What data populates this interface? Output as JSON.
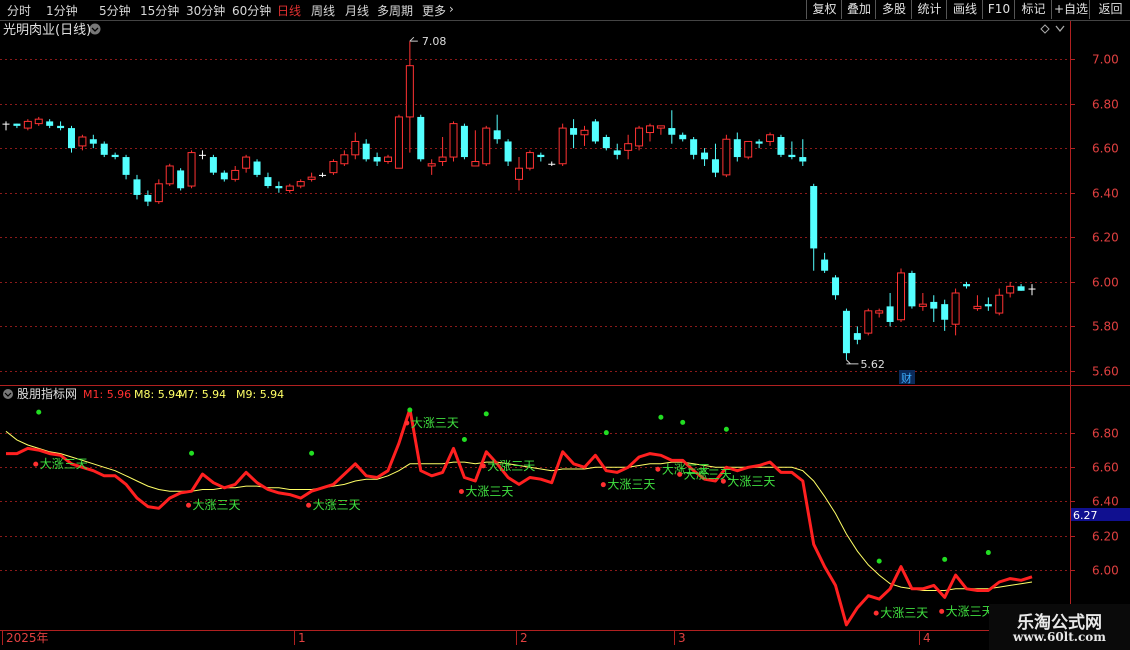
{
  "toolbar": {
    "tabs": [
      "分时",
      "1分钟",
      "5分钟",
      "15分钟",
      "30分钟",
      "60分钟",
      "日线",
      "周线",
      "月线",
      "多周期",
      "更多"
    ],
    "active_tab": "日线",
    "right_buttons": [
      "复权",
      "叠加",
      "多股",
      "统计",
      "画线",
      "F10",
      "标记",
      "+自选",
      "返回"
    ]
  },
  "main_panel": {
    "title": "光明肉业(日线)",
    "high_label": "7.08",
    "low_label": "5.62",
    "event_marker": "财",
    "yaxis_labels": [
      "7.00",
      "6.80",
      "6.60",
      "6.40",
      "6.20",
      "6.00",
      "5.80",
      "5.60"
    ],
    "yaxis_values": [
      7.0,
      6.8,
      6.6,
      6.4,
      6.2,
      6.0,
      5.8,
      5.6
    ],
    "ylim": [
      5.55,
      7.15
    ]
  },
  "indicator_panel": {
    "title": "股朋指标网",
    "legend": [
      {
        "label": "M1: 5.96",
        "color": "#ff3030"
      },
      {
        "label": "M8: 5.94",
        "color": "#ffff66"
      },
      {
        "label": "M7: 5.94",
        "color": "#ffff66"
      },
      {
        "label": "M9: 5.94",
        "color": "#ffff66"
      }
    ],
    "signal_label": "大涨三天",
    "cursor_value": "6.27",
    "yaxis_labels": [
      "6.80",
      "6.60",
      "6.40",
      "6.20",
      "6.00"
    ],
    "yaxis_values": [
      6.8,
      6.6,
      6.4,
      6.2,
      6.0
    ],
    "ylim": [
      5.65,
      7.0
    ]
  },
  "dates": [
    "2025年",
    "1",
    "2",
    "3",
    "4"
  ],
  "watermark": {
    "line1": "乐淘公式网",
    "line2": "www.60lt.com"
  },
  "colors": {
    "up": "#ff3333",
    "down": "#54ffff",
    "doji": "#ffffff",
    "m1": "#ff2020",
    "ma": "#ffff66",
    "signal": "#22dd22",
    "grid": "#8b1a1a",
    "axis": "#b02020"
  },
  "chart_data": {
    "type": "candlestick",
    "candles": [
      [
        6.71,
        6.72,
        6.68,
        6.71
      ],
      [
        6.71,
        6.71,
        6.69,
        6.7
      ],
      [
        6.69,
        6.73,
        6.68,
        6.72
      ],
      [
        6.71,
        6.74,
        6.7,
        6.73
      ],
      [
        6.72,
        6.73,
        6.69,
        6.7
      ],
      [
        6.7,
        6.72,
        6.68,
        6.69
      ],
      [
        6.69,
        6.7,
        6.58,
        6.6
      ],
      [
        6.61,
        6.66,
        6.59,
        6.65
      ],
      [
        6.64,
        6.66,
        6.6,
        6.62
      ],
      [
        6.62,
        6.63,
        6.56,
        6.57
      ],
      [
        6.57,
        6.58,
        6.55,
        6.56
      ],
      [
        6.56,
        6.57,
        6.46,
        6.48
      ],
      [
        6.46,
        6.48,
        6.37,
        6.39
      ],
      [
        6.39,
        6.41,
        6.34,
        6.36
      ],
      [
        6.36,
        6.46,
        6.35,
        6.44
      ],
      [
        6.44,
        6.53,
        6.43,
        6.52
      ],
      [
        6.5,
        6.51,
        6.41,
        6.42
      ],
      [
        6.43,
        6.59,
        6.42,
        6.58
      ],
      [
        6.57,
        6.59,
        6.55,
        6.57
      ],
      [
        6.56,
        6.57,
        6.48,
        6.49
      ],
      [
        6.49,
        6.5,
        6.45,
        6.46
      ],
      [
        6.46,
        6.52,
        6.45,
        6.5
      ],
      [
        6.51,
        6.57,
        6.49,
        6.56
      ],
      [
        6.54,
        6.55,
        6.47,
        6.48
      ],
      [
        6.47,
        6.49,
        6.42,
        6.43
      ],
      [
        6.43,
        6.45,
        6.4,
        6.42
      ],
      [
        6.41,
        6.44,
        6.4,
        6.43
      ],
      [
        6.43,
        6.46,
        6.42,
        6.45
      ],
      [
        6.46,
        6.49,
        6.45,
        6.47
      ],
      [
        6.48,
        6.49,
        6.47,
        6.48
      ],
      [
        6.49,
        6.55,
        6.48,
        6.54
      ],
      [
        6.53,
        6.59,
        6.52,
        6.57
      ],
      [
        6.57,
        6.67,
        6.55,
        6.63
      ],
      [
        6.62,
        6.64,
        6.54,
        6.55
      ],
      [
        6.56,
        6.58,
        6.52,
        6.54
      ],
      [
        6.54,
        6.57,
        6.53,
        6.56
      ],
      [
        6.51,
        6.75,
        6.51,
        6.74
      ],
      [
        6.74,
        7.08,
        6.58,
        6.97
      ],
      [
        6.74,
        6.75,
        6.54,
        6.55
      ],
      [
        6.52,
        6.55,
        6.48,
        6.53
      ],
      [
        6.54,
        6.65,
        6.52,
        6.56
      ],
      [
        6.56,
        6.72,
        6.54,
        6.71
      ],
      [
        6.7,
        6.71,
        6.55,
        6.56
      ],
      [
        6.52,
        6.68,
        6.52,
        6.54
      ],
      [
        6.53,
        6.7,
        6.52,
        6.69
      ],
      [
        6.68,
        6.75,
        6.62,
        6.64
      ],
      [
        6.63,
        6.64,
        6.52,
        6.54
      ],
      [
        6.46,
        6.56,
        6.41,
        6.51
      ],
      [
        6.51,
        6.59,
        6.5,
        6.58
      ],
      [
        6.57,
        6.58,
        6.54,
        6.56
      ],
      [
        6.53,
        6.54,
        6.52,
        6.53
      ],
      [
        6.53,
        6.71,
        6.52,
        6.69
      ],
      [
        6.69,
        6.73,
        6.6,
        6.66
      ],
      [
        6.66,
        6.7,
        6.61,
        6.68
      ],
      [
        6.72,
        6.73,
        6.62,
        6.63
      ],
      [
        6.65,
        6.66,
        6.59,
        6.6
      ],
      [
        6.59,
        6.62,
        6.55,
        6.57
      ],
      [
        6.59,
        6.66,
        6.55,
        6.62
      ],
      [
        6.61,
        6.7,
        6.59,
        6.69
      ],
      [
        6.67,
        6.71,
        6.63,
        6.7
      ],
      [
        6.69,
        6.7,
        6.66,
        6.7
      ],
      [
        6.69,
        6.77,
        6.62,
        6.66
      ],
      [
        6.66,
        6.67,
        6.63,
        6.64
      ],
      [
        6.64,
        6.65,
        6.55,
        6.57
      ],
      [
        6.58,
        6.6,
        6.52,
        6.55
      ],
      [
        6.55,
        6.62,
        6.47,
        6.49
      ],
      [
        6.48,
        6.66,
        6.47,
        6.64
      ],
      [
        6.64,
        6.67,
        6.54,
        6.56
      ],
      [
        6.56,
        6.63,
        6.55,
        6.63
      ],
      [
        6.63,
        6.64,
        6.6,
        6.62
      ],
      [
        6.63,
        6.67,
        6.61,
        6.66
      ],
      [
        6.65,
        6.66,
        6.56,
        6.57
      ],
      [
        6.57,
        6.63,
        6.55,
        6.56
      ],
      [
        6.56,
        6.64,
        6.52,
        6.54
      ],
      [
        6.43,
        6.44,
        6.05,
        6.15
      ],
      [
        6.1,
        6.13,
        6.04,
        6.05
      ],
      [
        6.02,
        6.03,
        5.92,
        5.94
      ],
      [
        5.87,
        5.88,
        5.65,
        5.68
      ],
      [
        5.77,
        5.8,
        5.72,
        5.74
      ],
      [
        5.77,
        5.88,
        5.76,
        5.87
      ],
      [
        5.86,
        5.88,
        5.84,
        5.87
      ],
      [
        5.89,
        5.95,
        5.8,
        5.82
      ],
      [
        5.83,
        6.06,
        5.82,
        6.04
      ],
      [
        6.04,
        6.05,
        5.88,
        5.89
      ],
      [
        5.89,
        5.95,
        5.87,
        5.9
      ],
      [
        5.91,
        5.94,
        5.82,
        5.88
      ],
      [
        5.9,
        5.92,
        5.78,
        5.83
      ],
      [
        5.81,
        5.97,
        5.76,
        5.95
      ],
      [
        5.99,
        6.0,
        5.97,
        5.98
      ],
      [
        5.88,
        5.94,
        5.87,
        5.89
      ],
      [
        5.9,
        5.93,
        5.87,
        5.89
      ],
      [
        5.86,
        5.97,
        5.85,
        5.94
      ],
      [
        5.95,
        6.0,
        5.93,
        5.98
      ],
      [
        5.98,
        5.99,
        5.96,
        5.96
      ],
      [
        5.97,
        5.99,
        5.94,
        5.97
      ]
    ],
    "m1": [
      6.68,
      6.68,
      6.71,
      6.7,
      6.68,
      6.67,
      6.62,
      6.6,
      6.58,
      6.55,
      6.55,
      6.5,
      6.42,
      6.37,
      6.36,
      6.42,
      6.45,
      6.46,
      6.56,
      6.51,
      6.48,
      6.5,
      6.57,
      6.51,
      6.47,
      6.45,
      6.44,
      6.42,
      6.46,
      6.48,
      6.5,
      6.56,
      6.62,
      6.55,
      6.54,
      6.58,
      6.74,
      6.94,
      6.58,
      6.55,
      6.57,
      6.71,
      6.54,
      6.52,
      6.69,
      6.62,
      6.54,
      6.5,
      6.54,
      6.53,
      6.51,
      6.69,
      6.62,
      6.6,
      6.67,
      6.58,
      6.57,
      6.6,
      6.66,
      6.68,
      6.67,
      6.64,
      6.64,
      6.58,
      6.53,
      6.52,
      6.6,
      6.58,
      6.6,
      6.61,
      6.63,
      6.57,
      6.57,
      6.52,
      6.15,
      6.02,
      5.91,
      5.68,
      5.78,
      5.85,
      5.83,
      5.89,
      6.02,
      5.89,
      5.89,
      5.91,
      5.84,
      5.97,
      5.89,
      5.88,
      5.88,
      5.93,
      5.95,
      5.94,
      5.96
    ],
    "ma": [
      6.81,
      6.76,
      6.73,
      6.71,
      6.69,
      6.68,
      6.66,
      6.64,
      6.62,
      6.6,
      6.58,
      6.55,
      6.52,
      6.49,
      6.47,
      6.46,
      6.46,
      6.46,
      6.47,
      6.47,
      6.48,
      6.48,
      6.49,
      6.49,
      6.48,
      6.48,
      6.47,
      6.47,
      6.47,
      6.48,
      6.49,
      6.5,
      6.52,
      6.53,
      6.53,
      6.55,
      6.58,
      6.62,
      6.62,
      6.62,
      6.62,
      6.63,
      6.63,
      6.62,
      6.63,
      6.63,
      6.62,
      6.61,
      6.6,
      6.59,
      6.58,
      6.59,
      6.59,
      6.59,
      6.6,
      6.6,
      6.6,
      6.6,
      6.61,
      6.62,
      6.62,
      6.63,
      6.63,
      6.62,
      6.61,
      6.6,
      6.6,
      6.6,
      6.6,
      6.6,
      6.6,
      6.6,
      6.6,
      6.58,
      6.52,
      6.43,
      6.33,
      6.21,
      6.11,
      6.03,
      5.97,
      5.92,
      5.9,
      5.89,
      5.88,
      5.88,
      5.88,
      5.89,
      5.89,
      5.89,
      5.89,
      5.9,
      5.91,
      5.92,
      5.93
    ],
    "signal_dots": [
      3,
      17,
      28,
      37,
      42,
      44,
      55,
      60,
      62,
      66,
      80,
      86,
      90
    ],
    "signal_labels": [
      3,
      17,
      28,
      37,
      42,
      44,
      55,
      60,
      62,
      66,
      80,
      86
    ]
  }
}
